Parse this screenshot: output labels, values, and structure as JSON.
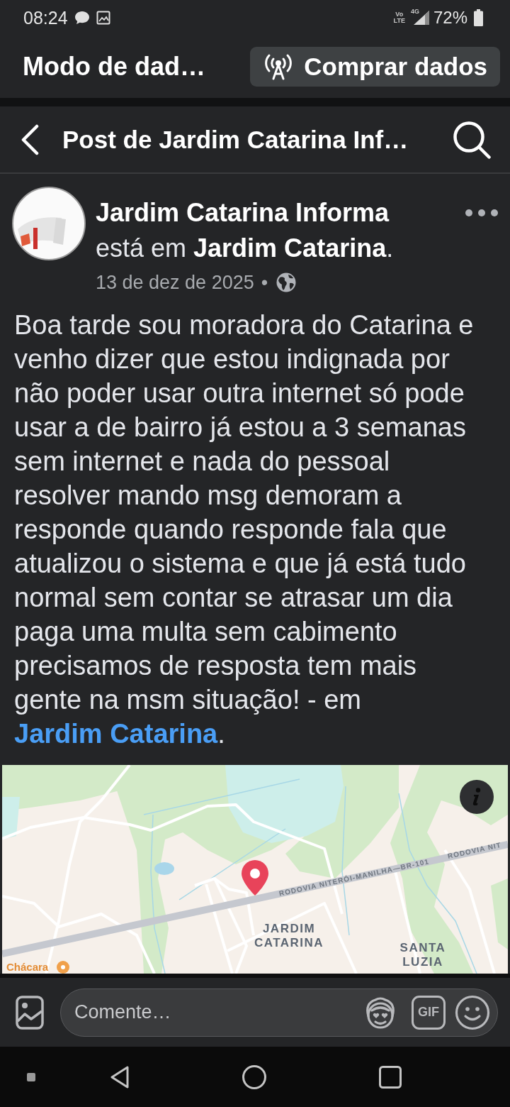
{
  "status_bar": {
    "time": "08:24",
    "volte": "Vo\nLTE",
    "network_type": "4G",
    "battery": "72%"
  },
  "data_bar": {
    "title": "Modo de dad…",
    "button": "Comprar dados"
  },
  "header": {
    "title": "Post de Jardim Catarina Inf…"
  },
  "post": {
    "author": "Jardim Catarina Informa",
    "location": "está em **Jardim Catarina**.",
    "date": "13 de dez de 2025",
    "separator": "•",
    "body": [
      {
        "kind": "text",
        "text": "Boa tarde sou moradora do Catarina e venho dizer que estou indignada por não poder usar outra internet só pode usar a de bairro já estou a 3 semanas sem internet e nada do pessoal resolver mando msg demoram a responde quando responde fala que atualizou o sistema e que já está tudo normal sem contar se atrasar um dia paga uma multa sem cabimento precisamos de resposta tem mais gente na msm situação! - em "
      },
      {
        "kind": "link",
        "text": "Jardim Catarina"
      },
      {
        "kind": "text",
        "text": "."
      }
    ],
    "map": {
      "labels": [
        {
          "kind": "road",
          "text": "RODOVIA NITERÓI-MANILHA—BR-101"
        },
        {
          "kind": "road",
          "text": "RODOVIA NIT"
        },
        {
          "kind": "area",
          "text": "JARDIM\nCATARINA"
        },
        {
          "kind": "area",
          "text": "SANTA\nLUZIA"
        },
        {
          "kind": "poi",
          "text": "Chácara"
        }
      ]
    }
  },
  "comment_bar": {
    "placeholder": "Comente…",
    "gif": "GIF"
  }
}
